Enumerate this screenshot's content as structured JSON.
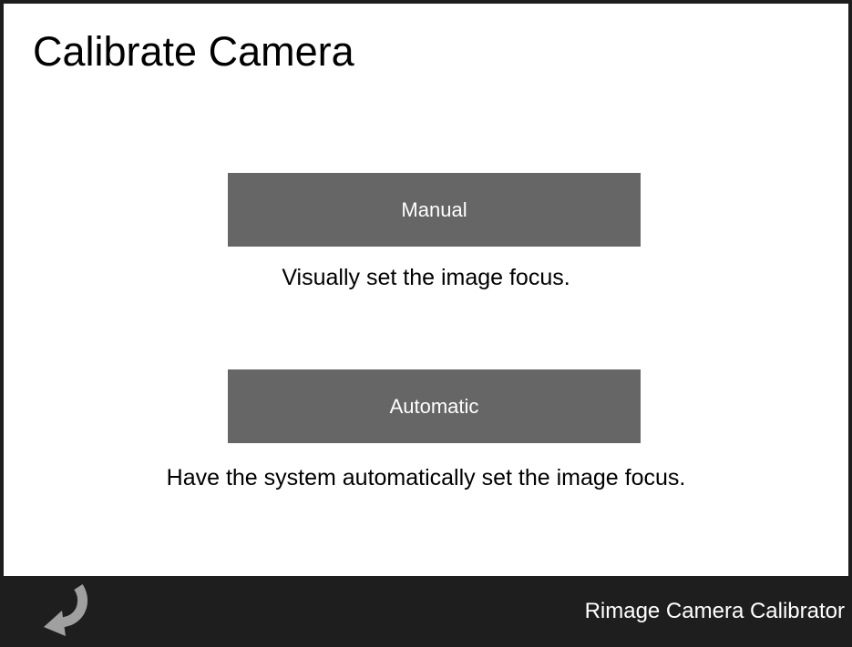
{
  "page": {
    "title": "Calibrate Camera"
  },
  "options": {
    "manual": {
      "label": "Manual",
      "description": "Visually set the image focus."
    },
    "automatic": {
      "label": "Automatic",
      "description": "Have the system automatically set the image focus."
    }
  },
  "footer": {
    "back_icon": "back-arrow-icon",
    "app_name": "Rimage Camera Calibrator"
  },
  "colors": {
    "button_bg": "#666666",
    "footer_bg": "#1e1e1e",
    "back_icon": "#a0a0a0"
  }
}
